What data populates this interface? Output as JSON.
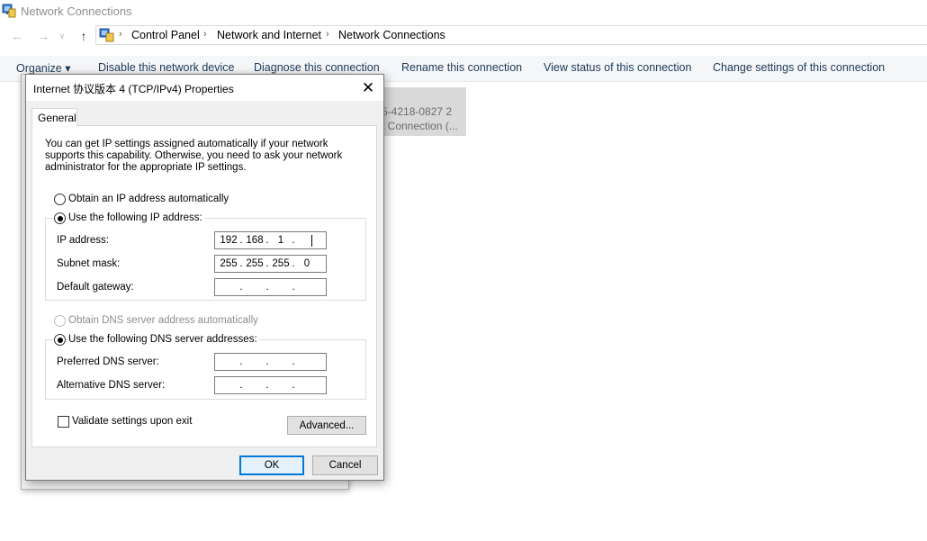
{
  "window": {
    "title": "Network Connections"
  },
  "nav": {
    "back_icon": "arrow-left-icon",
    "forward_icon": "arrow-right-icon",
    "recent_icon": "chevron-down-icon",
    "up_icon": "arrow-up-icon"
  },
  "breadcrumb": [
    "Control Panel",
    "Network and Internet",
    "Network Connections"
  ],
  "commands": {
    "organize": "Organize ▾",
    "disable": "Disable this network device",
    "diagnose": "Diagnose this connection",
    "rename": "Rename this connection",
    "view_status": "View status of this connection",
    "change_settings": "Change settings of this connection"
  },
  "connection_item": {
    "line1": "5-4218-0827 2",
    "line2": "t Connection (..."
  },
  "dialog": {
    "title": "Internet 协议版本 4 (TCP/IPv4) Properties",
    "tab_general": "General",
    "description": "You can get IP settings assigned automatically if your network supports this capability. Otherwise, you need to ask your network administrator for the appropriate IP settings.",
    "ip_auto_label": "Obtain an IP address automatically",
    "ip_manual_label": "Use the following IP address:",
    "ip_address_label": "IP address:",
    "ip_address": [
      "192",
      "168",
      "1",
      ""
    ],
    "subnet_mask_label": "Subnet mask:",
    "subnet_mask": [
      "255",
      "255",
      "255",
      "0"
    ],
    "default_gateway_label": "Default gateway:",
    "default_gateway": [
      "",
      "",
      "",
      ""
    ],
    "dns_auto_label": "Obtain DNS server address automatically",
    "dns_manual_label": "Use the following DNS server addresses:",
    "preferred_dns_label": "Preferred DNS server:",
    "preferred_dns": [
      "",
      "",
      "",
      ""
    ],
    "alternate_dns_label": "Alternative DNS server:",
    "alternate_dns": [
      "",
      "",
      "",
      ""
    ],
    "validate_label": "Validate settings upon exit",
    "advanced_button": "Advanced...",
    "ok_button": "OK",
    "cancel_button": "Cancel",
    "selected_ip_mode": "manual",
    "selected_dns_mode": "manual",
    "validate_checked": false
  },
  "colors": {
    "accent": "#0078d7",
    "command_text": "#1e395b"
  }
}
